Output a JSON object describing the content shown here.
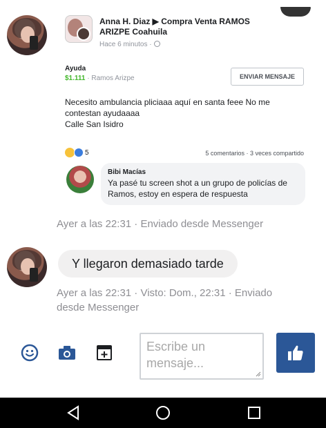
{
  "shared_post": {
    "author_line": "Anna H. Diaz ▶ Compra Venta RAMOS ARIZPE Coahuila",
    "time": "Hace 6 minutos ·",
    "sale": {
      "title": "Ayuda",
      "price": "$1.111",
      "location": "· Ramos Arizpe",
      "button_label": "ENVIAR MENSAJE"
    },
    "body_lines": [
      "Necesito ambulancia pliciaaa aquí en santa feee No me",
      "contestan ayudaaaa",
      "Calle San Isidro"
    ],
    "reactions_count": "5",
    "stats": "5 comentarios · 3 veces compartido",
    "comment": {
      "author": "Bibi Macías",
      "text": "Ya pasé tu screen shot a un grupo de policías de Ramos, estoy en espera de respuesta"
    }
  },
  "messages": [
    {
      "meta": "Ayer a las 22:31 · Enviado desde Messenger"
    },
    {
      "text": "Y llegaron demasiado tarde",
      "meta_line1": "Ayer a las 22:31 · Visto: Dom., 22:31 · Enviado",
      "meta_line2": "desde Messenger"
    }
  ],
  "composer": {
    "placeholder_line1": "Escribe un",
    "placeholder_line2": "mensaje...",
    "icons": [
      "emoji-icon",
      "camera-icon",
      "sticker-icon",
      "thumbs-up-icon"
    ],
    "accent_color": "#2b5797"
  },
  "navbar": {
    "icons": [
      "back-icon",
      "home-icon",
      "recents-icon"
    ]
  }
}
